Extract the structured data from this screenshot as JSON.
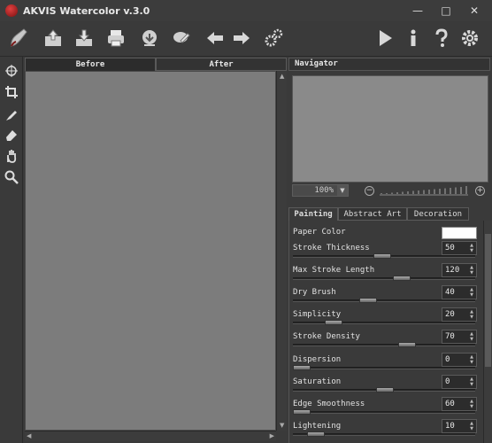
{
  "window": {
    "title": "AKVIS Watercolor v.3.0",
    "controls": {
      "minimize": "—",
      "maximize": "□",
      "close": "✕"
    }
  },
  "toolbar": {
    "left_buttons": [
      "brush-logo-icon",
      "open-image-icon",
      "save-image-icon",
      "print-icon",
      "publish-icon",
      "share-icon",
      "undo-icon",
      "redo-icon",
      "preferences-icon"
    ],
    "right_buttons": [
      "run-icon",
      "info-icon",
      "help-icon",
      "settings-gear-icon"
    ]
  },
  "tools": [
    "crop-move-icon",
    "crop-icon",
    "brush-tool-icon",
    "eraser-tool-icon",
    "hand-tool-icon",
    "zoom-tool-icon"
  ],
  "canvas_tabs": {
    "before": "Before",
    "after": "After",
    "active": "before"
  },
  "navigator": {
    "title": "Navigator",
    "zoom": "100%",
    "zoom_out": "−",
    "zoom_in": "+"
  },
  "settings_tabs": {
    "painting": "Painting",
    "abstract_art": "Abstract Art",
    "decoration": "Decoration",
    "active": "painting"
  },
  "parameters": {
    "paper_color": {
      "label": "Paper Color",
      "value": "#ffffff"
    },
    "stroke_thickness": {
      "label": "Stroke Thickness",
      "value": "50"
    },
    "max_stroke_length": {
      "label": "Max Stroke Length",
      "value": "120"
    },
    "dry_brush": {
      "label": "Dry Brush",
      "value": "40"
    },
    "simplicity": {
      "label": "Simplicity",
      "value": "20"
    },
    "stroke_density": {
      "label": "Stroke Density",
      "value": "70"
    },
    "dispersion": {
      "label": "Dispersion",
      "value": "0"
    },
    "saturation": {
      "label": "Saturation",
      "value": "0"
    },
    "edge_smoothness": {
      "label": "Edge Smoothness",
      "value": "60"
    },
    "lightening": {
      "label": "Lightening",
      "value": "10"
    }
  },
  "colors": {
    "background": "#3a3a3a",
    "canvas": "#7c7c7c",
    "navigator_preview": "#8a8a8a"
  }
}
